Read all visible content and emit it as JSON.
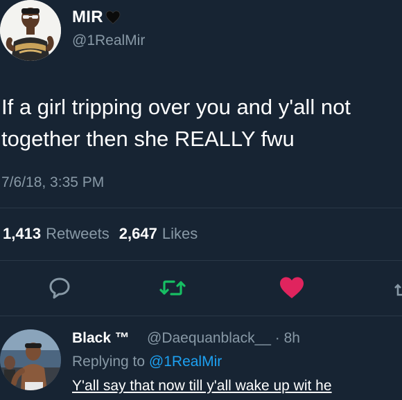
{
  "author": {
    "display_name": "MIR",
    "badge_icon": "black-heart-icon",
    "handle": "@1RealMir"
  },
  "tweet": {
    "text": "If a girl tripping over you and y'all not together then she REALLY fwu",
    "timestamp": "7/6/18, 3:35 PM"
  },
  "stats": {
    "retweets_count": "1,413",
    "retweets_label": "Retweets",
    "likes_count": "2,647",
    "likes_label": "Likes"
  },
  "actions": {
    "reply_icon": "reply-bubble-icon",
    "retweet_icon": "retweet-icon",
    "like_icon": "heart-icon",
    "share_icon": "share-icon"
  },
  "reply": {
    "display_name": "Black ™",
    "handle_time": "@Daequanblack__ · 8h",
    "replying_prefix": "Replying to",
    "replying_mention": "@1RealMir",
    "text": "Y'all say that now till y'all wake up wit he"
  },
  "colors": {
    "background": "#172433",
    "secondary_text": "#8899a6",
    "retweet_active": "#17bf63",
    "like_active": "#e0245e",
    "link": "#1da1f2"
  }
}
